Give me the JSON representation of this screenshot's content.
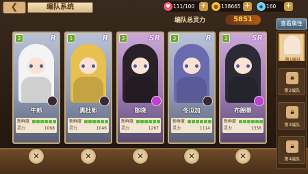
{
  "header": {
    "back_icon": "back-arrow-icon",
    "title": "编队系统"
  },
  "resources": {
    "stamina": "111/100",
    "gold": "138665",
    "gems": "160"
  },
  "power": {
    "label": "编队总灵力",
    "value": "5851"
  },
  "attr_button": "查看属性",
  "cards": [
    {
      "name": "牛郎",
      "rarity": "R",
      "star": "3",
      "fresh_label": "新鲜度",
      "power_label": "灵力",
      "power": "1068",
      "color": "#f4f4f4"
    },
    {
      "name": "黑杜郎",
      "rarity": "R",
      "star": "1",
      "fresh_label": "新鲜度",
      "power_label": "灵力",
      "power": "1046",
      "color": "#e8c050"
    },
    {
      "name": "陈晓",
      "rarity": "SR",
      "star": "3",
      "fresh_label": "新鲜度",
      "power_label": "灵力",
      "power": "1267",
      "color": "#2a2028"
    },
    {
      "name": "冬瓜加",
      "rarity": "R",
      "star": "3",
      "fresh_label": "新鲜度",
      "power_label": "灵力",
      "power": "1114",
      "color": "#6a6ab0"
    },
    {
      "name": "布朗蒂",
      "rarity": "SR",
      "star": "3",
      "fresh_label": "新鲜度",
      "power_label": "灵力",
      "power": "1356",
      "color": "#2c2a34"
    }
  ],
  "teams": [
    {
      "label": "第1编队",
      "active": true
    },
    {
      "label": "第2编队",
      "active": false
    },
    {
      "label": "第3编队",
      "active": false
    },
    {
      "label": "第4编队",
      "active": false
    }
  ]
}
